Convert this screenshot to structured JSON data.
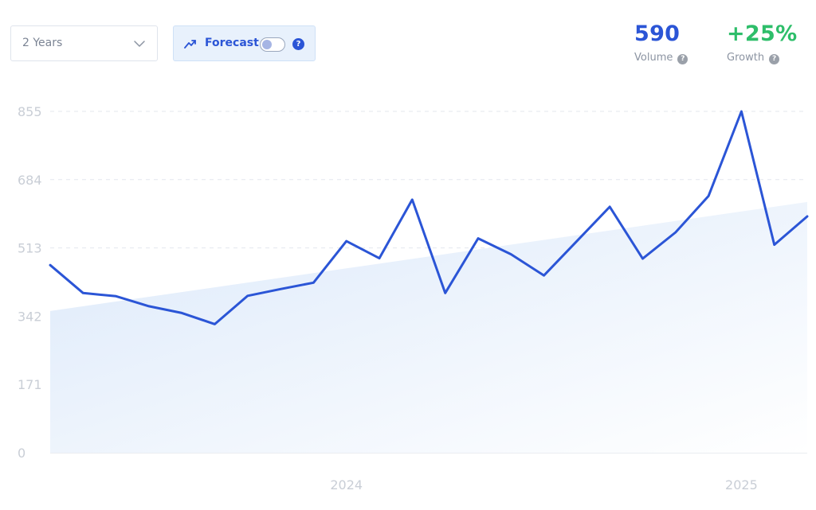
{
  "controls": {
    "range": {
      "value": "2 Years",
      "icon": "chevron-down-icon"
    },
    "forecast": {
      "label": "Forecast",
      "icon": "trending-up-icon",
      "enabled": false,
      "help_glyph": "?"
    }
  },
  "stats": {
    "volume": {
      "value": "590",
      "label": "Volume",
      "color": "#2b55d6",
      "help_glyph": "?"
    },
    "growth": {
      "value": "+25%",
      "label": "Growth",
      "color": "#2ebe6a",
      "help_glyph": "?"
    }
  },
  "colors": {
    "line": "#2b55d6",
    "area_start": "#dce9fa",
    "area_end": "#ffffff",
    "grid": "#e3e7ee",
    "tick_text": "#c9ced6"
  },
  "chart_data": {
    "type": "line",
    "y_ticks": [
      0,
      171,
      342,
      513,
      684,
      855
    ],
    "ylim": [
      0,
      855
    ],
    "x_tick_labels": [
      {
        "label": "2024",
        "index": 9
      },
      {
        "label": "2025",
        "index": 21
      }
    ],
    "grid": "horizontal dashed",
    "series": [
      {
        "values": [
          470,
          400,
          392,
          367,
          350,
          322,
          393,
          410,
          426,
          530,
          487,
          634,
          400,
          537,
          497,
          444,
          530,
          616,
          486,
          552,
          643,
          855,
          521,
          592
        ]
      }
    ],
    "trend": {
      "start": 355,
      "end": 628
    }
  }
}
